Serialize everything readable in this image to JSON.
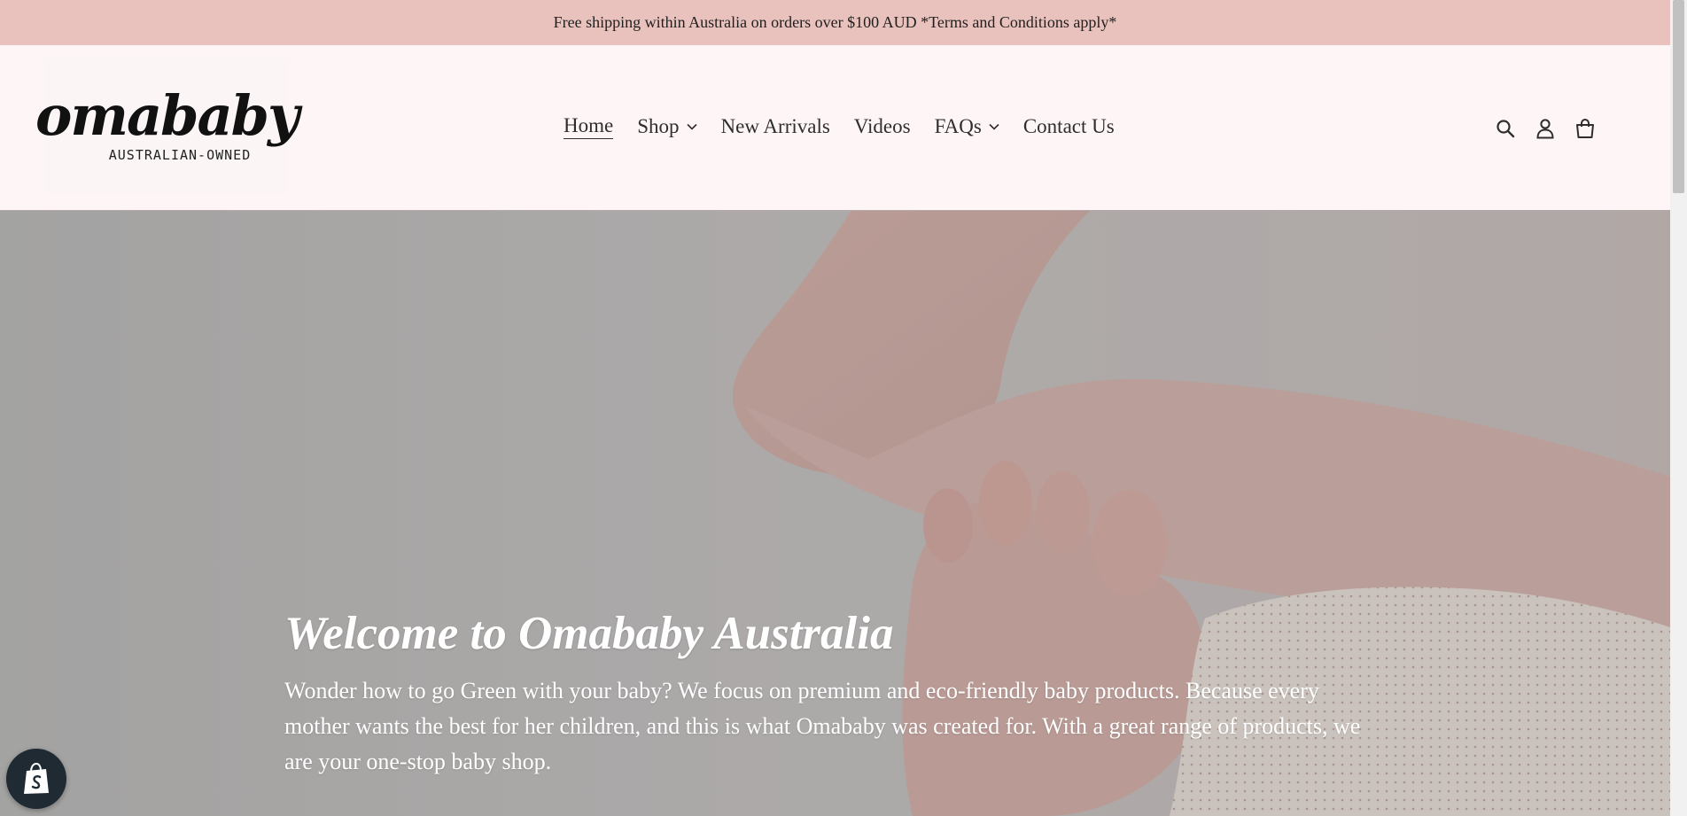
{
  "announcement": {
    "text": "Free shipping within Australia on orders over $100 AUD *Terms and Conditions apply*"
  },
  "logo": {
    "script": "omababy",
    "tagline": "AUSTRALIAN-OWNED"
  },
  "nav": {
    "home": "Home",
    "shop": "Shop",
    "new_arrivals": "New Arrivals",
    "videos": "Videos",
    "faqs": "FAQs",
    "contact": "Contact Us"
  },
  "header_icons": [
    "search-icon",
    "account-icon",
    "cart-icon"
  ],
  "hero": {
    "title": "Welcome to Omababy Australia",
    "text": "Wonder how to go Green with your baby? We focus on premium and eco-friendly baby products. Because every mother wants the best for her children, and this is what Omababy was created for. With a great range of products, we are your one-stop baby shop."
  },
  "colors": {
    "announcement_bg": "#e9c2bd",
    "header_bg": "#fef6f6",
    "text": "#2e2e2e",
    "badge_bg": "#1f2a33"
  }
}
